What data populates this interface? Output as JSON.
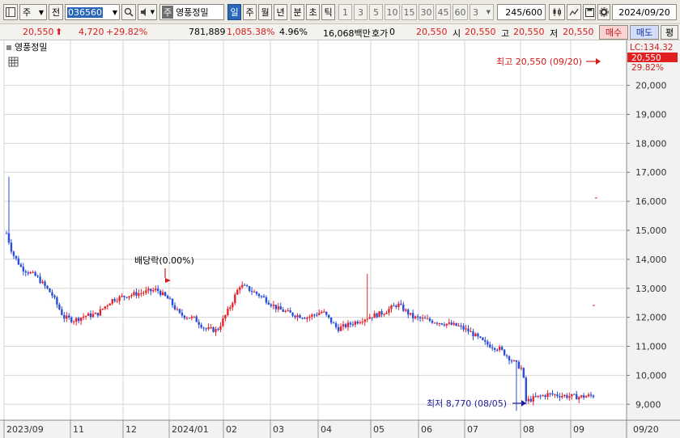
{
  "toolbar": {
    "market": "주",
    "scope": "전",
    "stock_code": "036560",
    "stock_name": "영풍정밀",
    "stock_tag": "주",
    "periods": [
      "일",
      "주",
      "월",
      "년",
      "분",
      "초",
      "틱"
    ],
    "active_period": "일",
    "intervals": [
      "1",
      "3",
      "5",
      "10",
      "15",
      "30",
      "45",
      "60"
    ],
    "interval_value": "3",
    "count_value": "245",
    "count_total": "/600",
    "date_value": "2024/09/20"
  },
  "quote": {
    "price": "20,550",
    "change": "4,720",
    "change_rate": "+29.82%",
    "volume": "781,889",
    "volume_rate": "1,085.38%",
    "turnover": "4.96%",
    "amount": "16,068백만",
    "hoga_label": "호가",
    "hoga_value": "0",
    "current": "20,550",
    "open_label": "시",
    "open": "20,550",
    "high_label": "고",
    "high": "20,550",
    "low_label": "저",
    "low": "20,550",
    "buy_label": "매수",
    "sell_label": "매도",
    "extra_label": "평"
  },
  "colors": {
    "up": "#e8232b",
    "down": "#2a4fd6",
    "grid": "#d6d6d6",
    "axis_bg": "#f2f2f2",
    "badge": "#e02020",
    "dark_blue": "#1e1e9a"
  },
  "chart_data": {
    "type": "candlestick",
    "legend": "영풍정밀",
    "y_ticks": [
      "20,000",
      "19,000",
      "18,000",
      "17,000",
      "16,000",
      "15,000",
      "14,000",
      "13,000",
      "12,000",
      "11,000",
      "10,000",
      "9,000"
    ],
    "x_ticks": [
      "2023/09",
      "11",
      "12",
      "2024/01",
      "02",
      "03",
      "04",
      "05",
      "06",
      "07",
      "08",
      "09"
    ],
    "axis_right_corner": "09/20",
    "ylim": [
      8450,
      21550
    ],
    "lc_label": "LC:134.32",
    "last_price_badge": "20,550",
    "last_rate": "29.82%",
    "high_annotation": "최고 20,550 (09/20)",
    "low_annotation": "최저 8,770 (08/05)",
    "dividend_annotation": "배당락(0.00%)",
    "key_points": [
      {
        "x": 0,
        "y": 14900
      },
      {
        "x": 4,
        "y": 14200
      },
      {
        "x": 10,
        "y": 13700
      },
      {
        "x": 20,
        "y": 13400
      },
      {
        "x": 30,
        "y": 12800
      },
      {
        "x": 38,
        "y": 12000
      },
      {
        "x": 45,
        "y": 11900
      },
      {
        "x": 52,
        "y": 12050
      },
      {
        "x": 60,
        "y": 12100
      },
      {
        "x": 70,
        "y": 12600
      },
      {
        "x": 80,
        "y": 12750
      },
      {
        "x": 90,
        "y": 12850
      },
      {
        "x": 100,
        "y": 12950
      },
      {
        "x": 108,
        "y": 12600
      },
      {
        "x": 115,
        "y": 12100
      },
      {
        "x": 125,
        "y": 11950
      },
      {
        "x": 132,
        "y": 11600
      },
      {
        "x": 140,
        "y": 11550
      },
      {
        "x": 148,
        "y": 12300
      },
      {
        "x": 155,
        "y": 13100
      },
      {
        "x": 160,
        "y": 13000
      },
      {
        "x": 170,
        "y": 12700
      },
      {
        "x": 180,
        "y": 12300
      },
      {
        "x": 190,
        "y": 12100
      },
      {
        "x": 200,
        "y": 12000
      },
      {
        "x": 210,
        "y": 12200
      },
      {
        "x": 220,
        "y": 11600
      },
      {
        "x": 230,
        "y": 11800
      },
      {
        "x": 240,
        "y": 12000
      },
      {
        "x": 250,
        "y": 12150
      },
      {
        "x": 260,
        "y": 12450
      },
      {
        "x": 270,
        "y": 12000
      },
      {
        "x": 280,
        "y": 11900
      },
      {
        "x": 290,
        "y": 11800
      },
      {
        "x": 300,
        "y": 11700
      },
      {
        "x": 308,
        "y": 11500
      },
      {
        "x": 318,
        "y": 11100
      },
      {
        "x": 328,
        "y": 10900
      },
      {
        "x": 336,
        "y": 10500
      },
      {
        "x": 343,
        "y": 10200
      },
      {
        "x": 345,
        "y": 9100
      },
      {
        "x": 350,
        "y": 9200
      },
      {
        "x": 360,
        "y": 9350
      },
      {
        "x": 370,
        "y": 9300
      },
      {
        "x": 380,
        "y": 9250
      },
      {
        "x": 390,
        "y": 9300
      }
    ]
  }
}
